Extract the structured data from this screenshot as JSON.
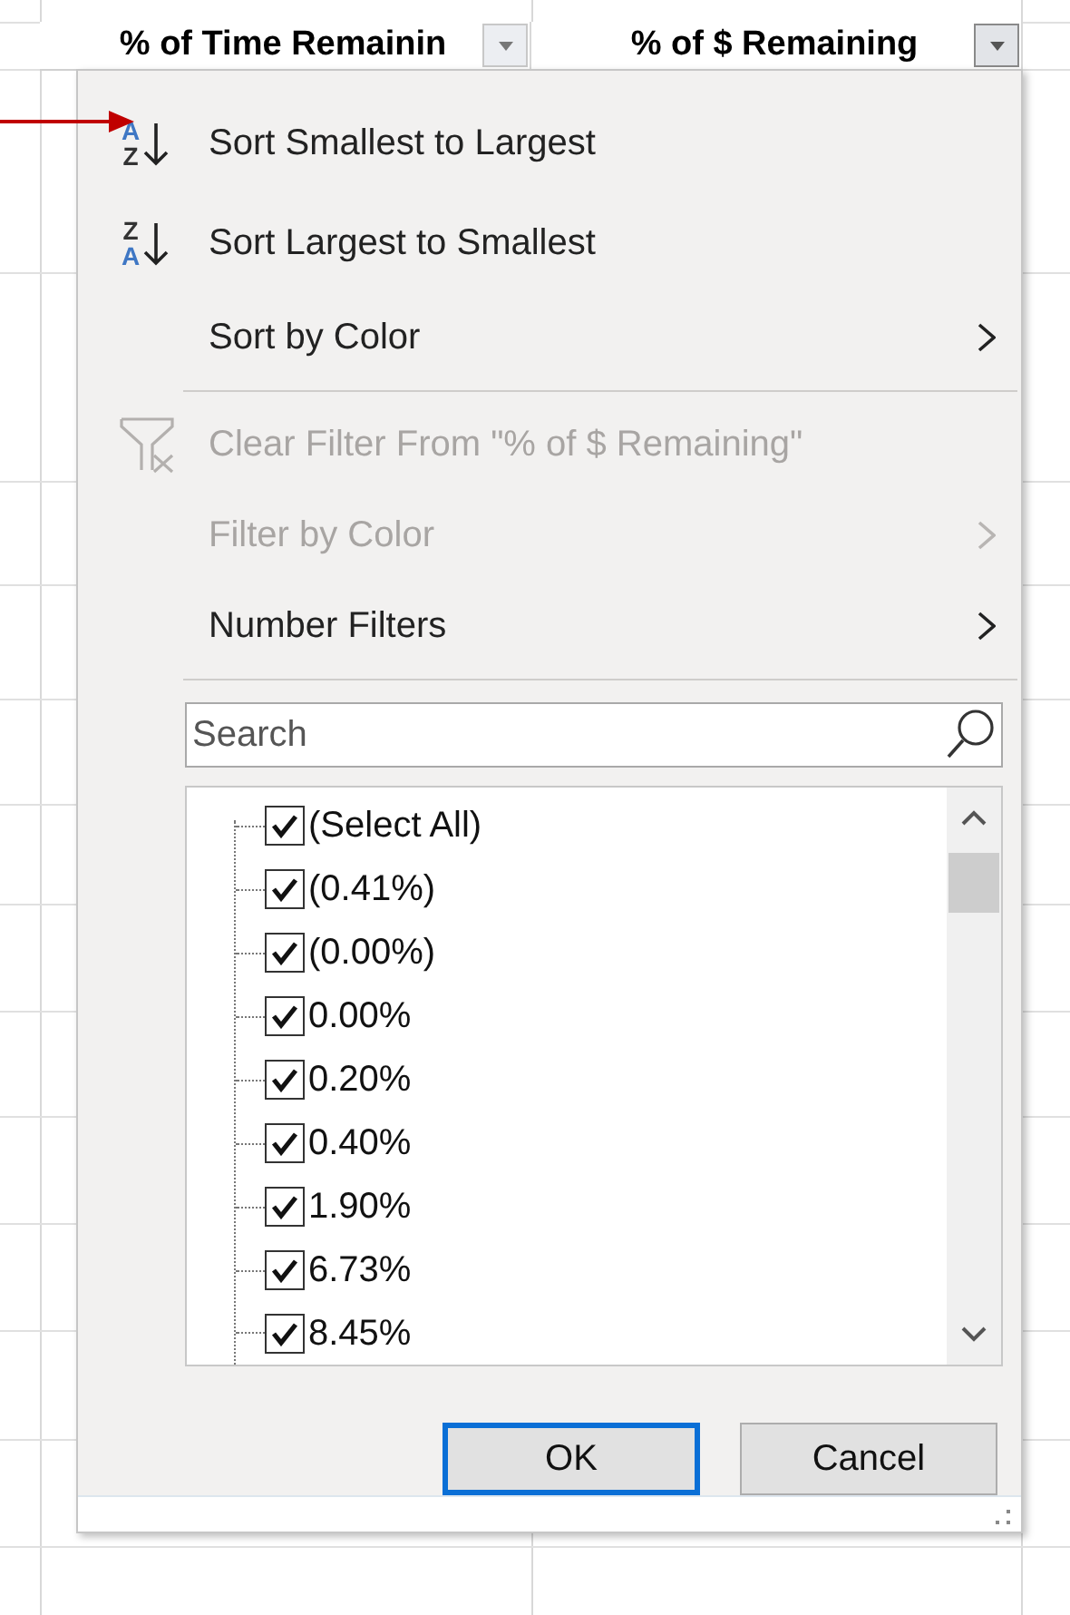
{
  "sheet": {
    "columns": [
      {
        "title": "% of Time Remainin",
        "filter_open": false
      },
      {
        "title": "% of $ Remaining",
        "filter_open": true
      }
    ]
  },
  "filter_menu": {
    "items": [
      {
        "kind": "sort-asc",
        "label": "Sort Smallest to Largest",
        "icon_letters": [
          "A",
          "Z"
        ],
        "disabled": false
      },
      {
        "kind": "sort-desc",
        "label": "Sort Largest to Smallest",
        "icon_letters": [
          "Z",
          "A"
        ],
        "disabled": false
      },
      {
        "kind": "submenu",
        "label": "Sort by Color",
        "disabled": false
      },
      {
        "kind": "separator"
      },
      {
        "kind": "clear",
        "label": "Clear Filter From \"% of $ Remaining\"",
        "disabled": true
      },
      {
        "kind": "submenu",
        "label": "Filter by Color",
        "disabled": true
      },
      {
        "kind": "submenu",
        "label": "Number Filters",
        "disabled": false
      },
      {
        "kind": "separator"
      }
    ],
    "search": {
      "placeholder": "Search"
    },
    "values": [
      {
        "label": "(Select All)",
        "checked": true
      },
      {
        "label": "(0.41%)",
        "checked": true
      },
      {
        "label": "(0.00%)",
        "checked": true
      },
      {
        "label": "0.00%",
        "checked": true
      },
      {
        "label": "0.20%",
        "checked": true
      },
      {
        "label": "0.40%",
        "checked": true
      },
      {
        "label": "1.90%",
        "checked": true
      },
      {
        "label": "6.73%",
        "checked": true
      },
      {
        "label": "8.45%",
        "checked": true
      }
    ],
    "buttons": [
      {
        "label": "OK",
        "focused": true
      },
      {
        "label": "Cancel",
        "focused": false
      }
    ]
  }
}
